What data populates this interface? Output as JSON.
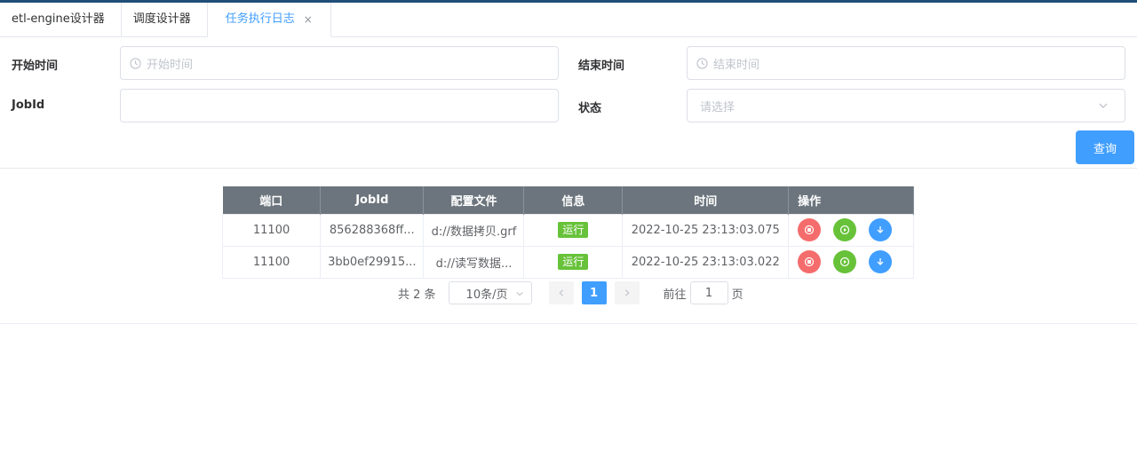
{
  "tabs": [
    {
      "label": "etl-engine设计器"
    },
    {
      "label": "调度设计器"
    },
    {
      "label": "任务执行日志",
      "close": "×"
    }
  ],
  "form": {
    "start_time": {
      "label": "开始时间",
      "placeholder": "开始时间"
    },
    "end_time": {
      "label": "结束时间",
      "placeholder": "结束时间"
    },
    "jobid": {
      "label": "JobId",
      "value": ""
    },
    "status": {
      "label": "状态",
      "placeholder": "请选择"
    },
    "query_label": "查询"
  },
  "table": {
    "headers": [
      "端口",
      "JobId",
      "配置文件",
      "信息",
      "时间",
      "操作"
    ],
    "rows": [
      {
        "port": "11100",
        "jobid": "856288368ff...",
        "config": "d://数据拷贝.grf",
        "info": "运行",
        "time": "2022-10-25 23:13:03.075"
      },
      {
        "port": "11100",
        "jobid": "3bb0ef29915...",
        "config": "d://读写数据...",
        "info": "运行",
        "time": "2022-10-25 23:13:03.022"
      }
    ]
  },
  "pager": {
    "total": "共 2 条",
    "page_size": "10条/页",
    "current_page": "1",
    "goto_label": "前往",
    "goto_value": "1",
    "page_suffix": "页"
  },
  "colors": {
    "accent": "#409eff",
    "header_bg": "#6c757d",
    "tag_green": "#67c23a",
    "stop_red": "#f56c6c",
    "topbar": "#1f4e79"
  },
  "icons": [
    "clock-icon",
    "chevron-down-icon",
    "stop-icon",
    "play-icon",
    "download-icon",
    "chevron-left-icon",
    "chevron-right-icon",
    "close-icon"
  ]
}
